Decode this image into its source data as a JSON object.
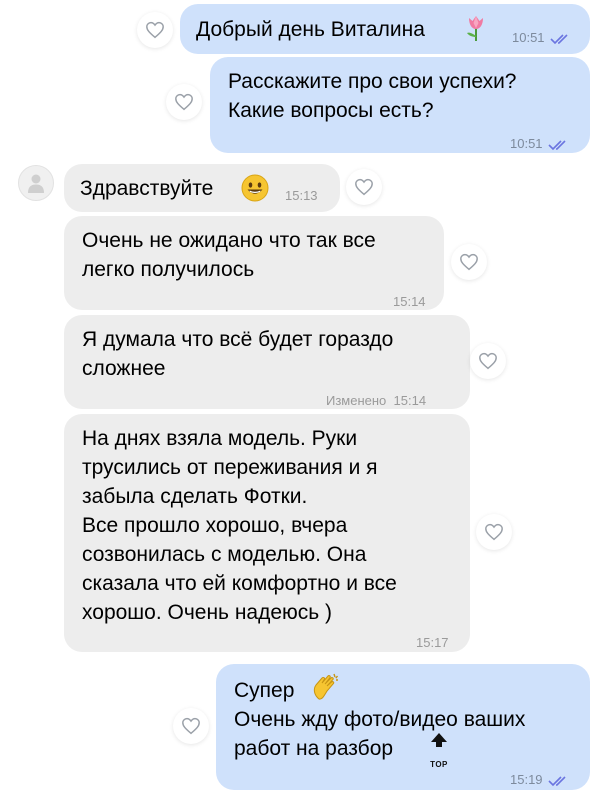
{
  "messages": [
    {
      "id": "m1",
      "dir": "out",
      "text": "Добрый день Виталина",
      "emoji": "tulip",
      "time": "10:51",
      "read": true
    },
    {
      "id": "m2",
      "dir": "out",
      "text": "Расскажите про свои успехи?\nКакие вопросы есть?",
      "time": "10:51",
      "read": true
    },
    {
      "id": "m3",
      "dir": "in",
      "text": "Здравствуйте",
      "emoji": "smile",
      "time": "15:13"
    },
    {
      "id": "m4",
      "dir": "in",
      "text": "Очень не ожидано что так все\nлегко получилось",
      "time": "15:14"
    },
    {
      "id": "m5",
      "dir": "in",
      "text": "Я думала что всё будет гораздо\nсложнее",
      "edited": "Изменено",
      "time": "15:14"
    },
    {
      "id": "m6",
      "dir": "in",
      "text": "На днях взяла модель. Руки\nтрусились от переживания и я\nзабыла сделать Фотки.\nВсе прошло хорошо, вчера\nсозвонилась с моделью. Она\nсказала что ей комфортно и все\nхорошо. Очень надеюсь )",
      "time": "15:17"
    },
    {
      "id": "m7",
      "dir": "out",
      "text_line1": "Супер",
      "emoji1": "clapping-hands",
      "text_rest": "Очень жду фото/видео ваших\nработ на разбор",
      "emoji2": "top-arrow",
      "top_label": "TOP",
      "time": "15:19",
      "read": true
    }
  ],
  "colors": {
    "outgoing": "#cfe1fb",
    "incoming": "#ededed",
    "read_ticks": "#6b75e0"
  }
}
